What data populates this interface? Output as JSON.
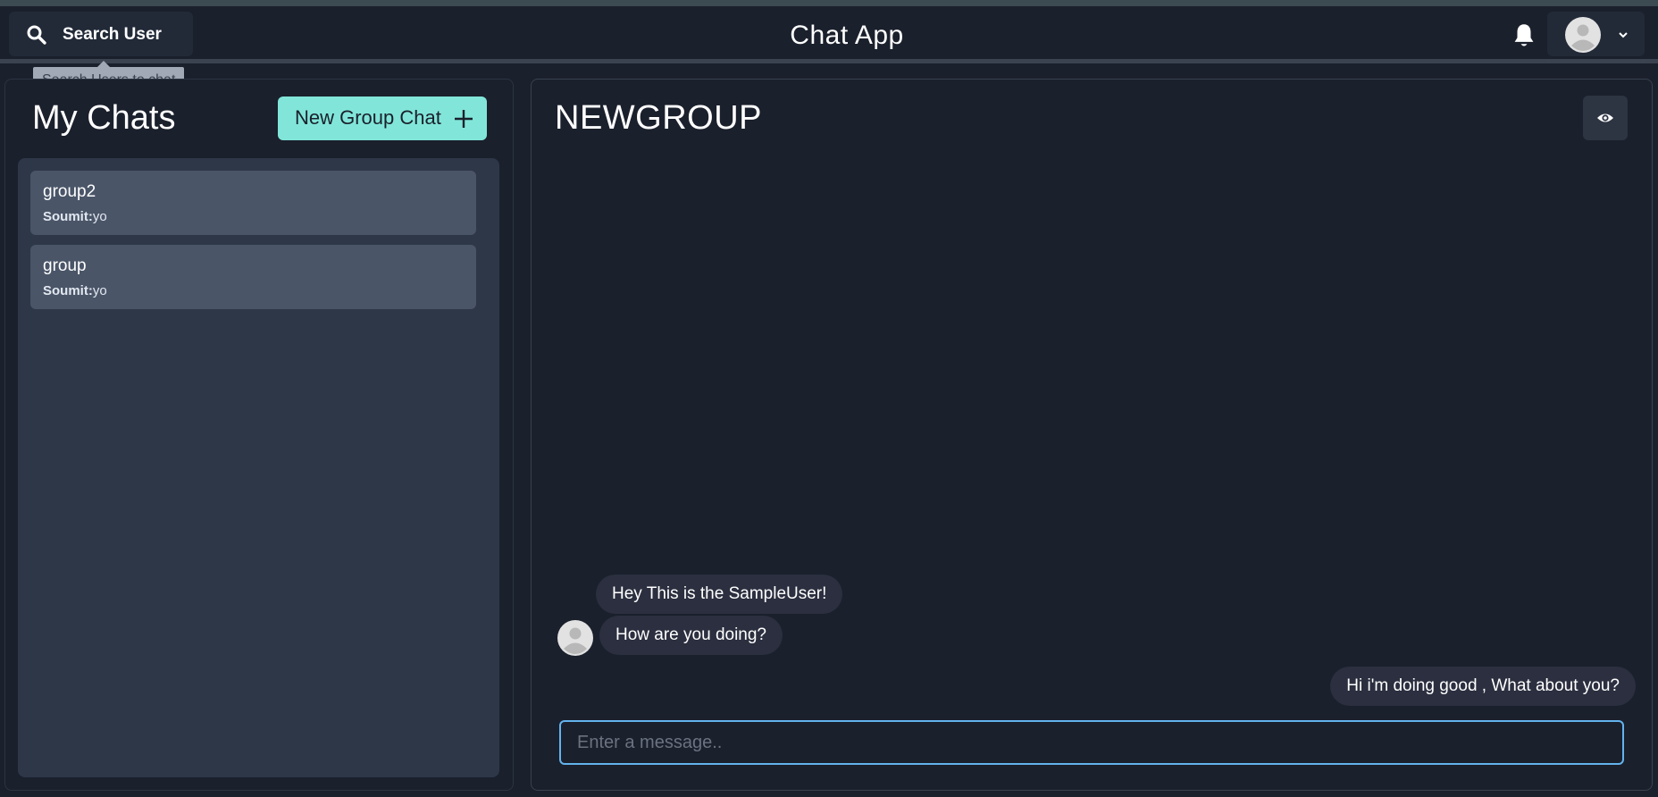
{
  "header": {
    "search_label": "Search User",
    "search_tooltip": "Search Users to chat",
    "app_title": "Chat App"
  },
  "sidebar": {
    "title": "My Chats",
    "new_group_label": "New Group Chat",
    "chats": [
      {
        "name": "group2",
        "sender": "Soumit:",
        "latest": "yo"
      },
      {
        "name": "group",
        "sender": "Soumit:",
        "latest": "yo"
      }
    ]
  },
  "chat": {
    "name": "NEWGROUP",
    "messages": [
      {
        "text": "Hey This is the SampleUser!",
        "from": "other"
      },
      {
        "text": "How are you doing?",
        "from": "other"
      },
      {
        "text": "Hi i'm doing good , What about you?",
        "from": "self"
      }
    ],
    "input_placeholder": "Enter a message.."
  },
  "colors": {
    "accent": "#81e6d9",
    "focus_border": "#63b3ed",
    "background": "#1a202c",
    "chat_item": "#4a5568"
  },
  "icons": [
    "search-icon",
    "bell-icon",
    "avatar-icon",
    "chevron-down-icon",
    "plus-icon",
    "eye-icon"
  ]
}
